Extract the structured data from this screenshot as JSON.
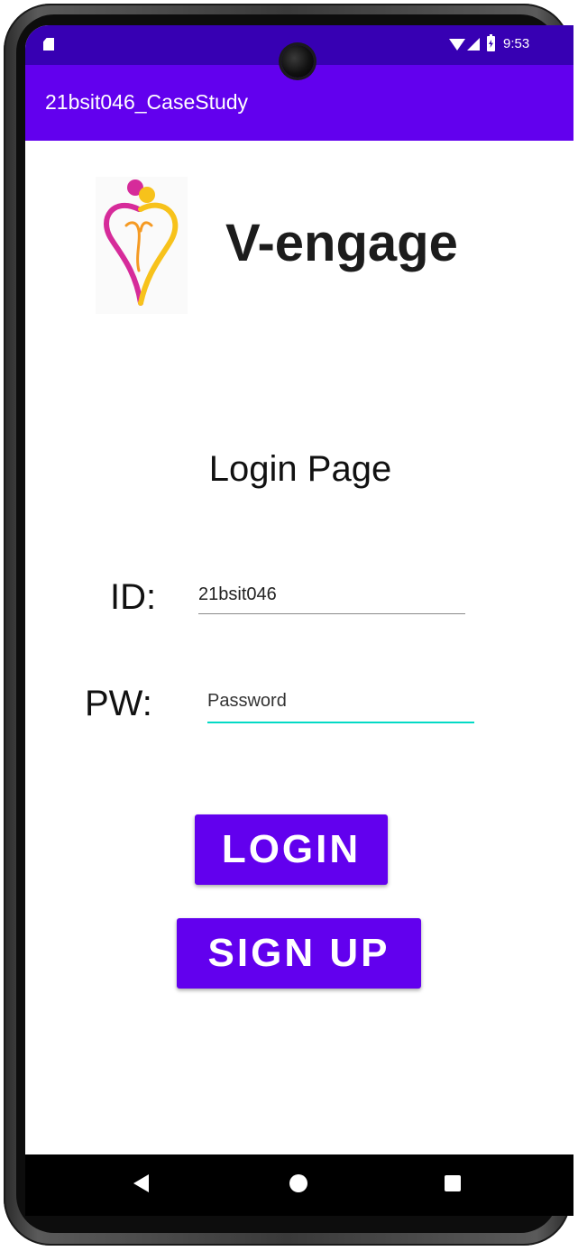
{
  "status_bar": {
    "time": "9:53",
    "icons": [
      "sd-card-icon",
      "wifi-icon",
      "signal-icon",
      "battery-charging-icon"
    ]
  },
  "app_bar": {
    "title": "21bsit046_CaseStudy"
  },
  "brand": {
    "logo": "heart-people-logo",
    "name": "V-engage"
  },
  "login_form": {
    "title": "Login Page",
    "id_label": "ID:",
    "id_value": "21bsit046",
    "pw_label": "PW:",
    "pw_placeholder": "Password"
  },
  "buttons": {
    "login": "LOGIN",
    "signup": "SIGN UP"
  },
  "nav_bar": {
    "icons": [
      "back-icon",
      "home-icon",
      "recents-icon"
    ]
  },
  "colors": {
    "status_bar": "#3700b3",
    "primary": "#6200ee",
    "accent": "#03dac5",
    "logo_pink": "#d62b9a",
    "logo_yellow": "#f7c21b",
    "logo_orange": "#f59a23"
  }
}
